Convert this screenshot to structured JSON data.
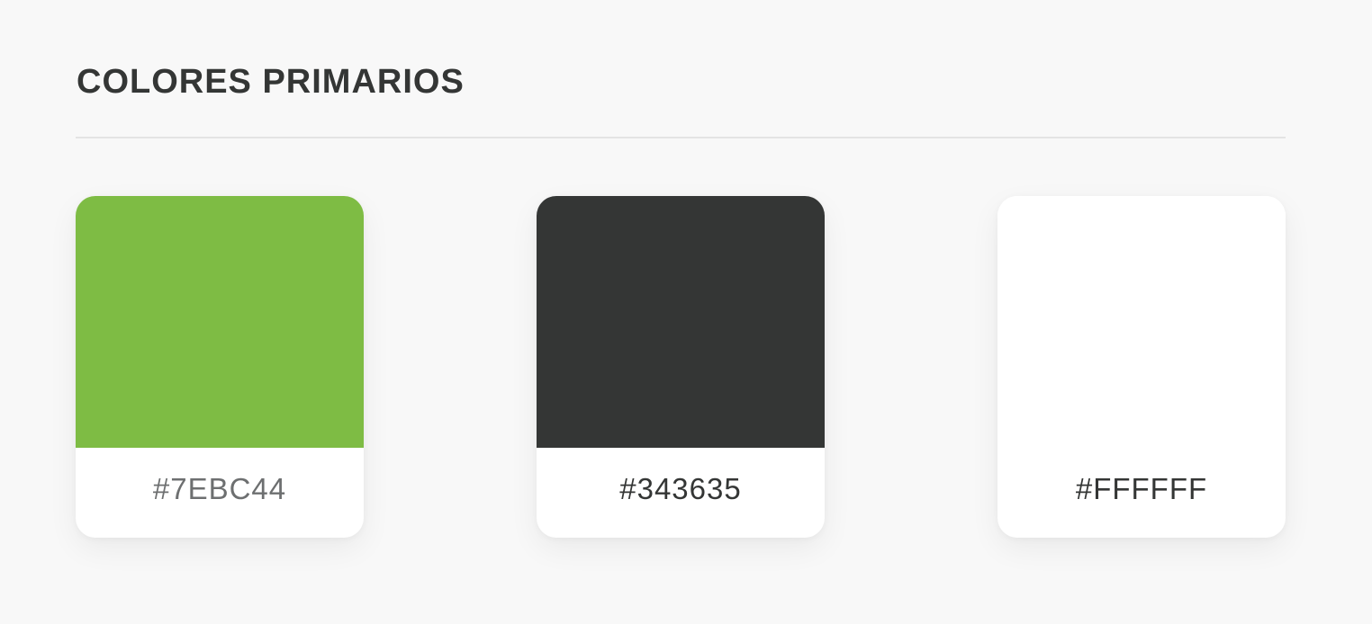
{
  "section": {
    "title": "COLORES PRIMARIOS"
  },
  "swatches": [
    {
      "label": "#7EBC44",
      "color": "#7EBC44"
    },
    {
      "label": "#343635",
      "color": "#343635"
    },
    {
      "label": "#FFFFFF",
      "color": "#FFFFFF"
    }
  ]
}
